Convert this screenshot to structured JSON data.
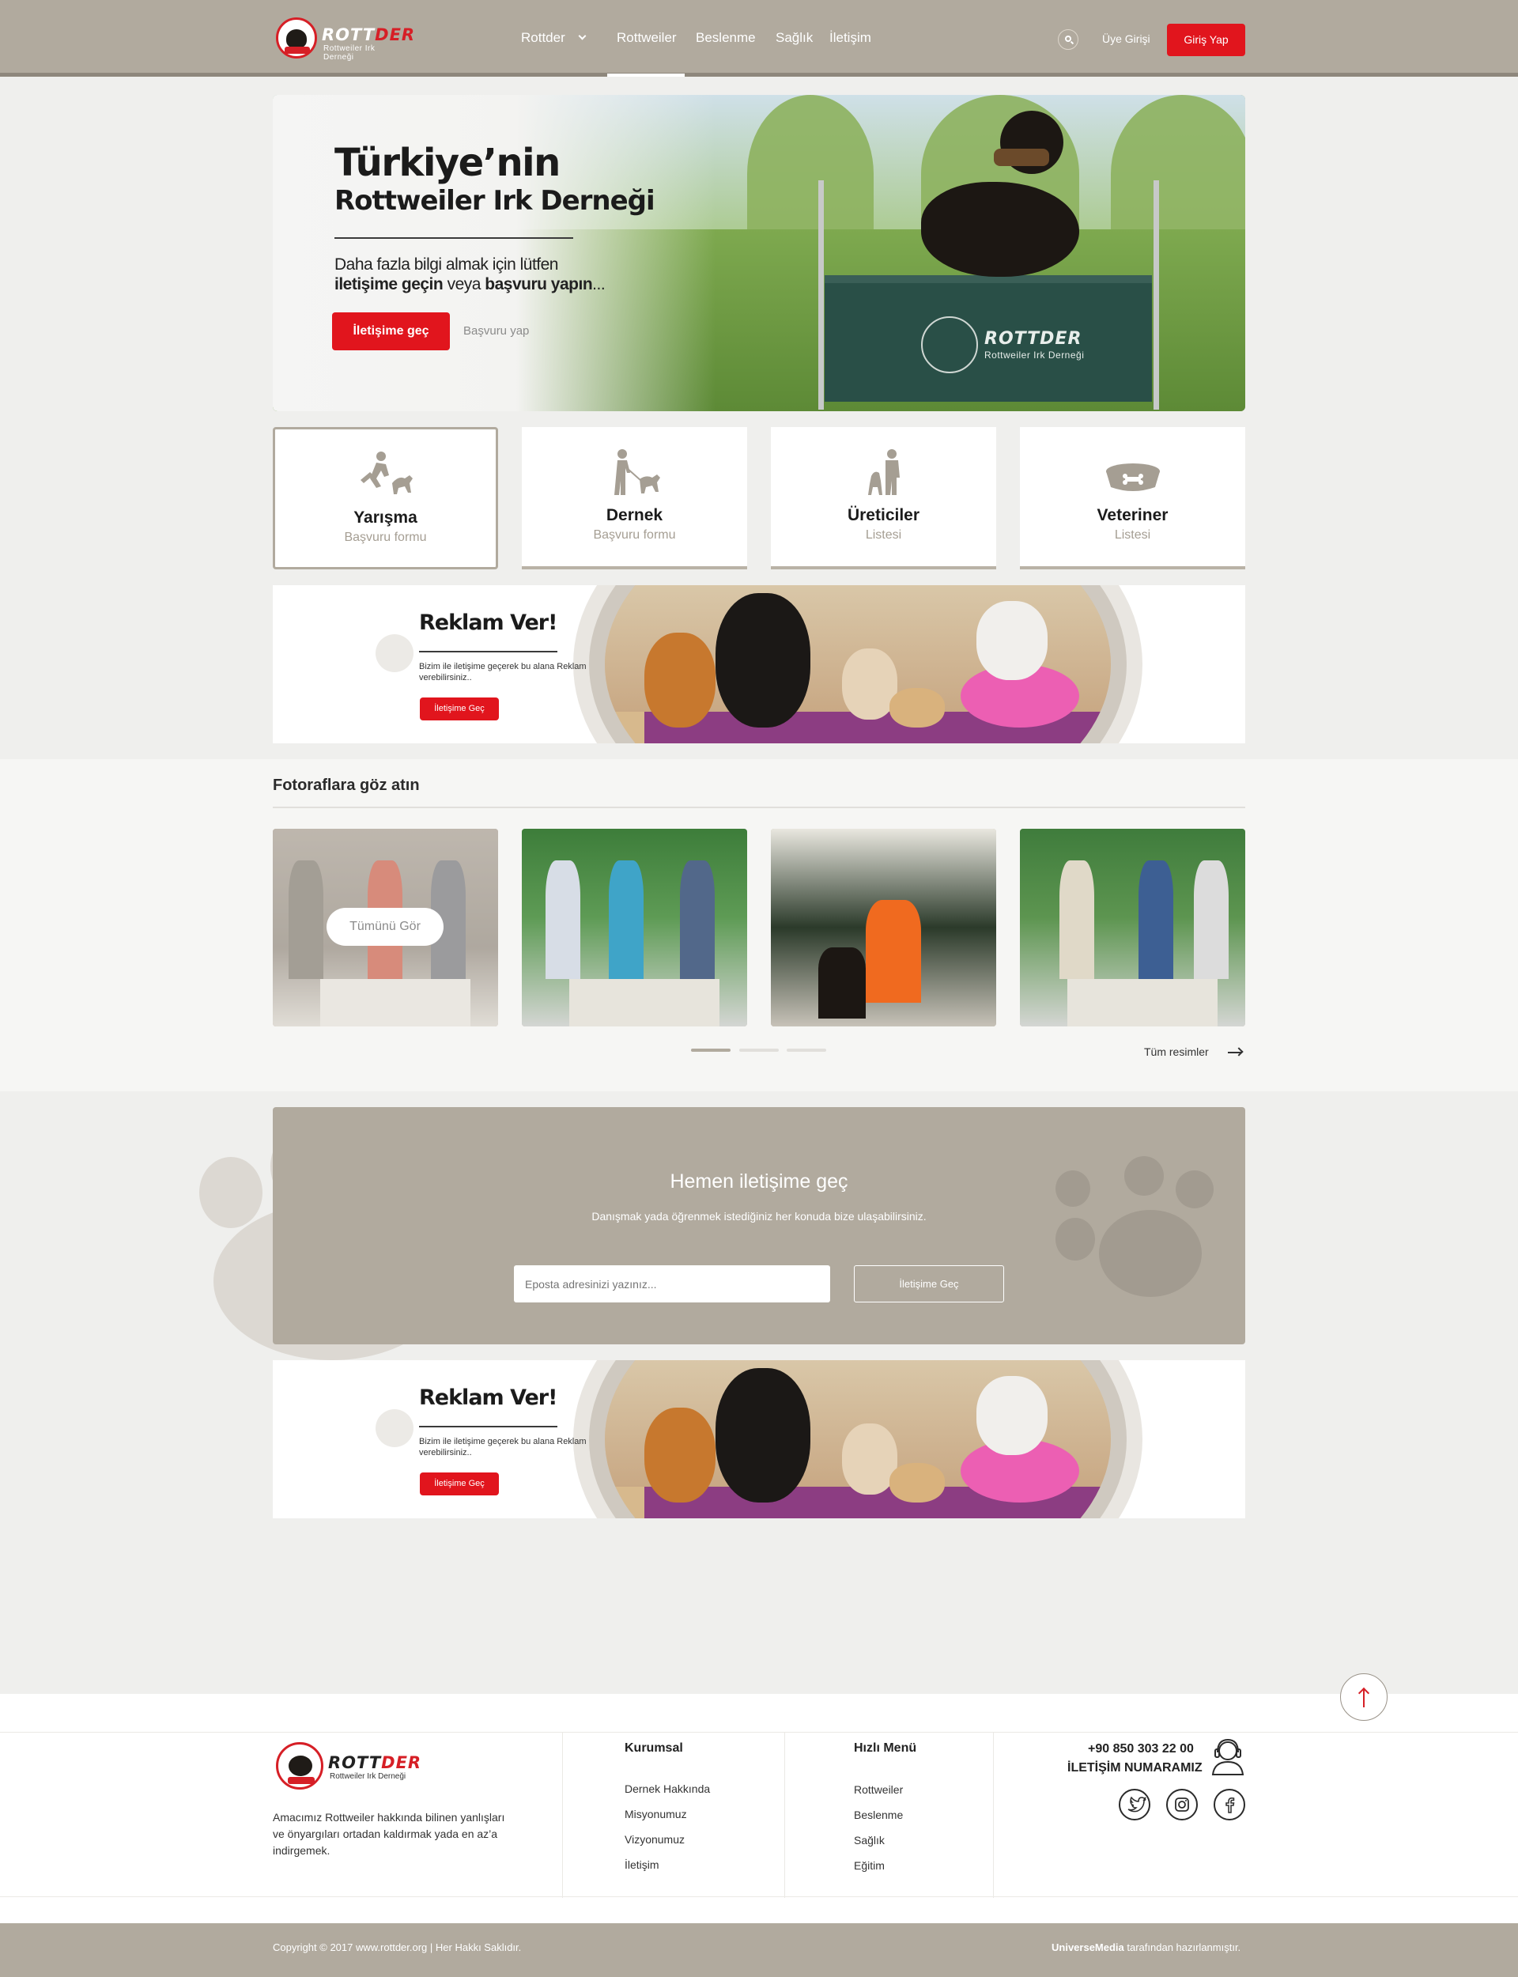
{
  "header": {
    "logo_text_a": "ROTT",
    "logo_text_b": "DER",
    "logo_sub": "Rottweiler Irk Derneği",
    "nav": [
      "Rottder",
      "Rottweiler",
      "Beslenme",
      "Sağlık",
      "İletişim"
    ],
    "active_nav": "Rottweiler",
    "member_login": "Üye Girişi",
    "login_button": "Giriş Yap"
  },
  "hero": {
    "title_line1": "Türkiye’nin",
    "title_line2": "Rottweiler  Irk Derneği",
    "desc_line1": "Daha fazla bilgi almak için lütfen",
    "desc_bold1": "iletişime geçin",
    "desc_mid": " veya ",
    "desc_bold2": "başvuru yapın",
    "desc_end": "...",
    "primary_button": "İletişime geç",
    "secondary_link": "Başvuru yap",
    "banner_text": "ROTTDER",
    "banner_sub": "Rottweiler Irk Derneği"
  },
  "cards": [
    {
      "title": "Yarışma",
      "subtitle": "Başvuru formu",
      "icon": "runner-dog-icon"
    },
    {
      "title": "Dernek",
      "subtitle": "Başvuru formu",
      "icon": "walker-dog-icon"
    },
    {
      "title": "Üreticiler",
      "subtitle": "Listesi",
      "icon": "breeder-dog-icon"
    },
    {
      "title": "Veteriner",
      "subtitle": "Listesi",
      "icon": "dog-bowl-icon"
    }
  ],
  "ads": [
    {
      "title": "Reklam Ver!",
      "text": "Bizim ile iletişime geçerek bu alana Reklam verebilirsiniz..",
      "button": "İletişime Geç"
    },
    {
      "title": "Reklam Ver!",
      "text": "Bizim ile iletişime geçerek bu alana Reklam verebilirsiniz..",
      "button": "İletişime Geç"
    }
  ],
  "photos": {
    "title": "Fotoraflara göz atın",
    "see_all": "Tümünü Gör",
    "all_link": "Tüm resimler",
    "carousel_pages": 3,
    "active_page": 1
  },
  "contact": {
    "title": "Hemen iletişime geç",
    "subtitle": "Danışmak yada öğrenmek istediğiniz her konuda bize ulaşabilirsiniz.",
    "email_placeholder": "Eposta adresinizi yazınız...",
    "button": "İletişime Geç"
  },
  "footer": {
    "logo_text_a": "ROTT",
    "logo_text_b": "DER",
    "logo_sub": "Rottweiler Irk Derneği",
    "description": "Amacımız Rottweiler hakkında bilinen yanlışları ve önyargıları ortadan kaldırmak yada en az’a indirgemek.",
    "col1_title": "Kurumsal",
    "col1_links": [
      "Dernek Hakkında",
      "Misyonumuz",
      "Vizyonumuz",
      "İletişim"
    ],
    "col2_title": "Hızlı Menü",
    "col2_links": [
      "Rottweiler",
      "Beslenme",
      "Sağlık",
      "Eğitim"
    ],
    "phone": "+90 850 303 22 00",
    "phone_label": "İLETİŞİM NUMARAMIZ",
    "social": [
      "twitter-icon",
      "instagram-icon",
      "facebook-icon"
    ]
  },
  "copyright": {
    "left": "Copyright © 2017 www.rottder.org | Her Hakkı Saklıdır.",
    "right_brand": "UniverseMedia",
    "right_text": " tarafından hazırlanmıştır."
  },
  "colors": {
    "brand_taupe": "#b1aa9e",
    "accent_red": "#e1151d"
  }
}
